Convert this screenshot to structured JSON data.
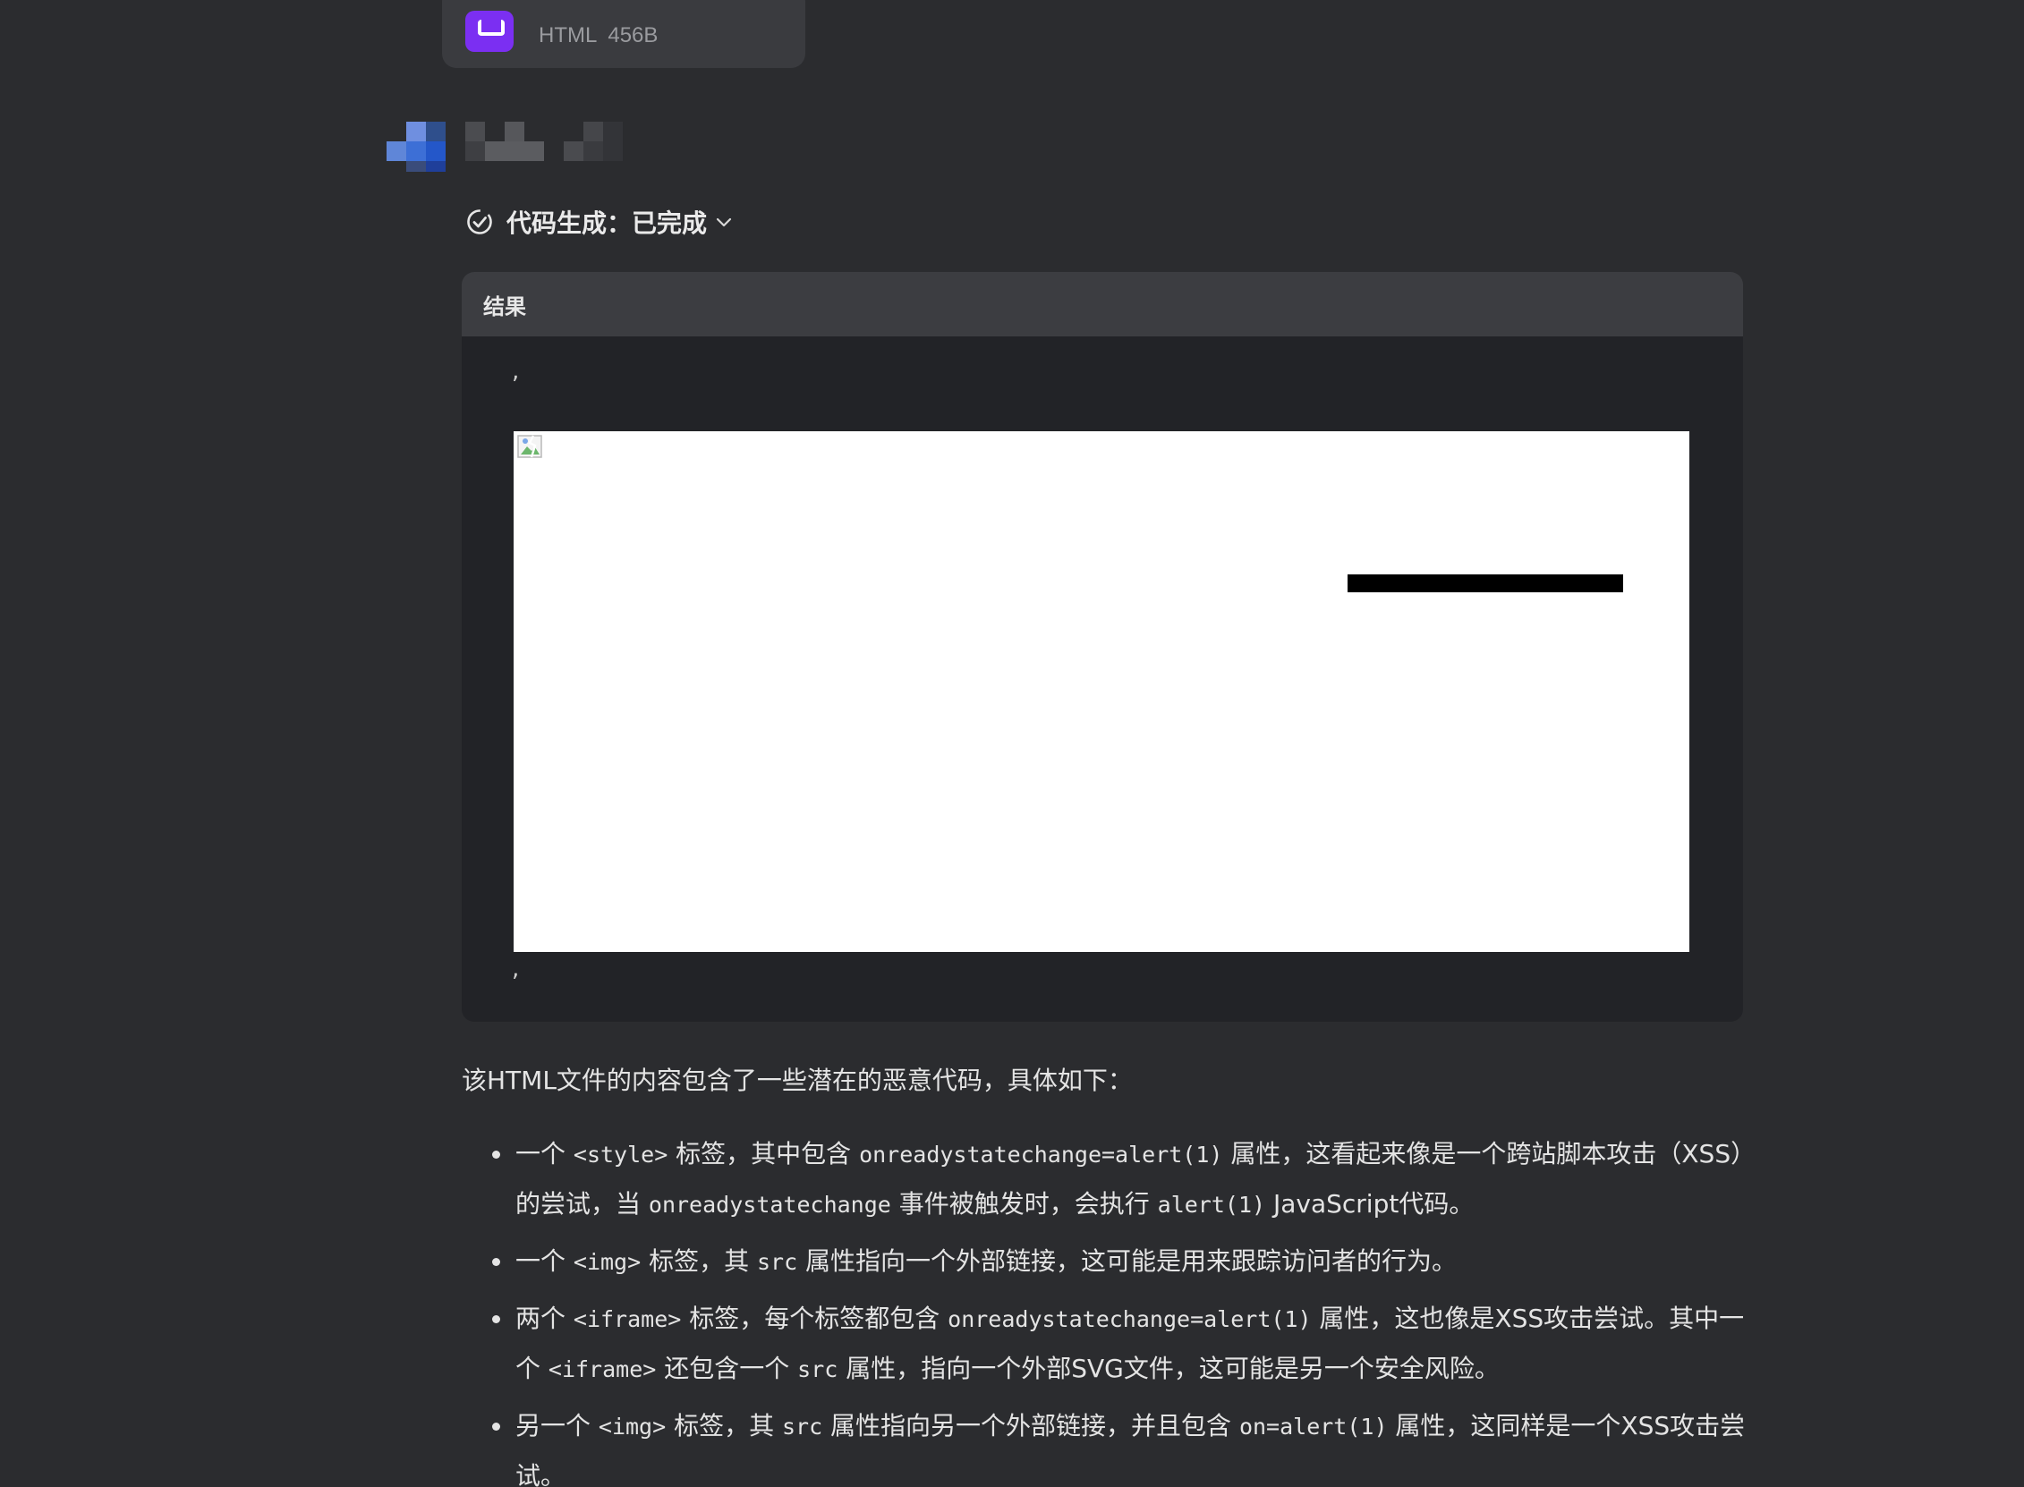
{
  "file_card": {
    "type_label": "HTML",
    "size_label": "456B"
  },
  "status": {
    "label": "代码生成：已完成"
  },
  "result": {
    "title": "结果",
    "comma_top": ",",
    "comma_bottom": ","
  },
  "explanation": {
    "intro": "该HTML文件的内容包含了一些潜在的恶意代码，具体如下：",
    "b1_a": "一个 ",
    "b1_code1": "<style>",
    "b1_b": " 标签，其中包含 ",
    "b1_code2": "onreadystatechange=alert(1)",
    "b1_c": " 属性，这看起来像是一个跨站脚本攻击（XSS）的尝试，当 ",
    "b1_code3": "onreadystatechange",
    "b1_d": " 事件被触发时，会执行 ",
    "b1_code4": "alert(1)",
    "b1_e": " JavaScript代码。",
    "b2_a": "一个 ",
    "b2_code1": "<img>",
    "b2_b": " 标签，其 ",
    "b2_code2": "src",
    "b2_c": " 属性指向一个外部链接，这可能是用来跟踪访问者的行为。",
    "b3_a": "两个 ",
    "b3_code1": "<iframe>",
    "b3_b": " 标签，每个标签都包含 ",
    "b3_code2": "onreadystatechange=alert(1)",
    "b3_c": " 属性，这也像是XSS攻击尝试。其中一个 ",
    "b3_code3": "<iframe>",
    "b3_d": " 还包含一个 ",
    "b3_code4": "src",
    "b3_e": " 属性，指向一个外部SVG文件，这可能是另一个安全风险。",
    "b4_a": "另一个 ",
    "b4_code1": "<img>",
    "b4_b": " 标签，其 ",
    "b4_code2": "src",
    "b4_c": " 属性指向另一个外部链接，并且包含 ",
    "b4_code3": "on=alert(1)",
    "b4_d": " 属性，这同样是一个XSS攻击尝试。"
  },
  "colors": {
    "background": "#2b2c2f",
    "panel": "#222327",
    "panel_header": "#3c3d41",
    "file_icon": "#7b2ff2"
  },
  "icons": [
    "html-file-icon",
    "check-circle-icon",
    "chevron-down-icon",
    "broken-image-icon"
  ]
}
